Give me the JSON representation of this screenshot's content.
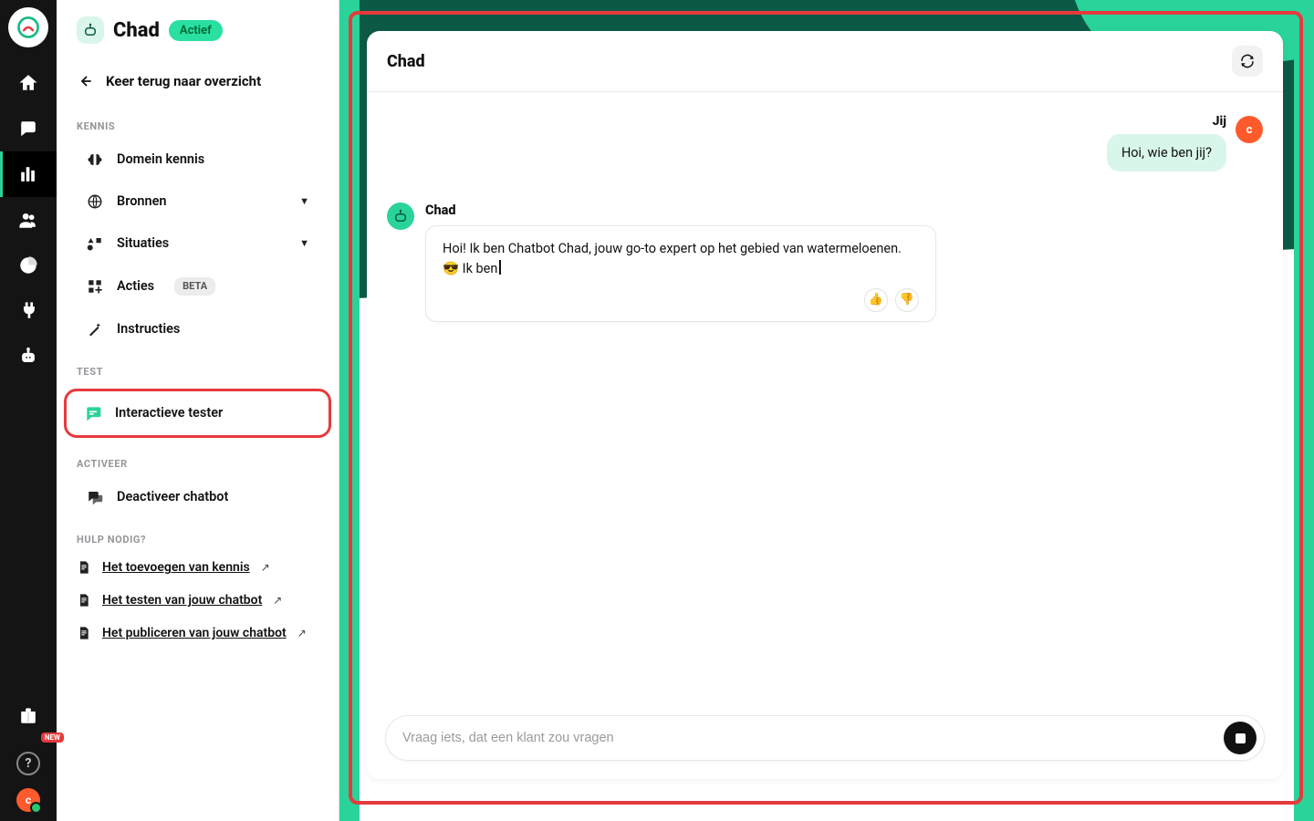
{
  "rail": {
    "new_badge": "NEW",
    "avatar_initial": "c"
  },
  "panel": {
    "title": "Chad",
    "status": "Actief",
    "back": "Keer terug naar overzicht",
    "sections": {
      "kennis": "KENNIS",
      "test": "TEST",
      "activeer": "ACTIVEER",
      "hulp": "HULP NODIG?"
    },
    "items": {
      "domein": "Domein kennis",
      "bronnen": "Bronnen",
      "situaties": "Situaties",
      "acties": "Acties",
      "acties_beta": "BETA",
      "instructies": "Instructies",
      "tester": "Interactieve tester",
      "deactiveer": "Deactiveer chatbot"
    },
    "help_links": {
      "h1": "Het toevoegen van kennis",
      "h2": "Het testen van jouw chatbot",
      "h3": "Het publiceren van jouw chatbot"
    }
  },
  "chat": {
    "header_title": "Chad",
    "user_name": "Jij",
    "user_avatar_initial": "c",
    "user_message": "Hoi, wie ben jij?",
    "bot_name": "Chad",
    "bot_message": "Hoi!  Ik ben Chatbot Chad, jouw go-to expert op het gebied van watermeloenen. 😎 Ik ben",
    "input_placeholder": "Vraag iets, dat een klant zou vragen"
  }
}
